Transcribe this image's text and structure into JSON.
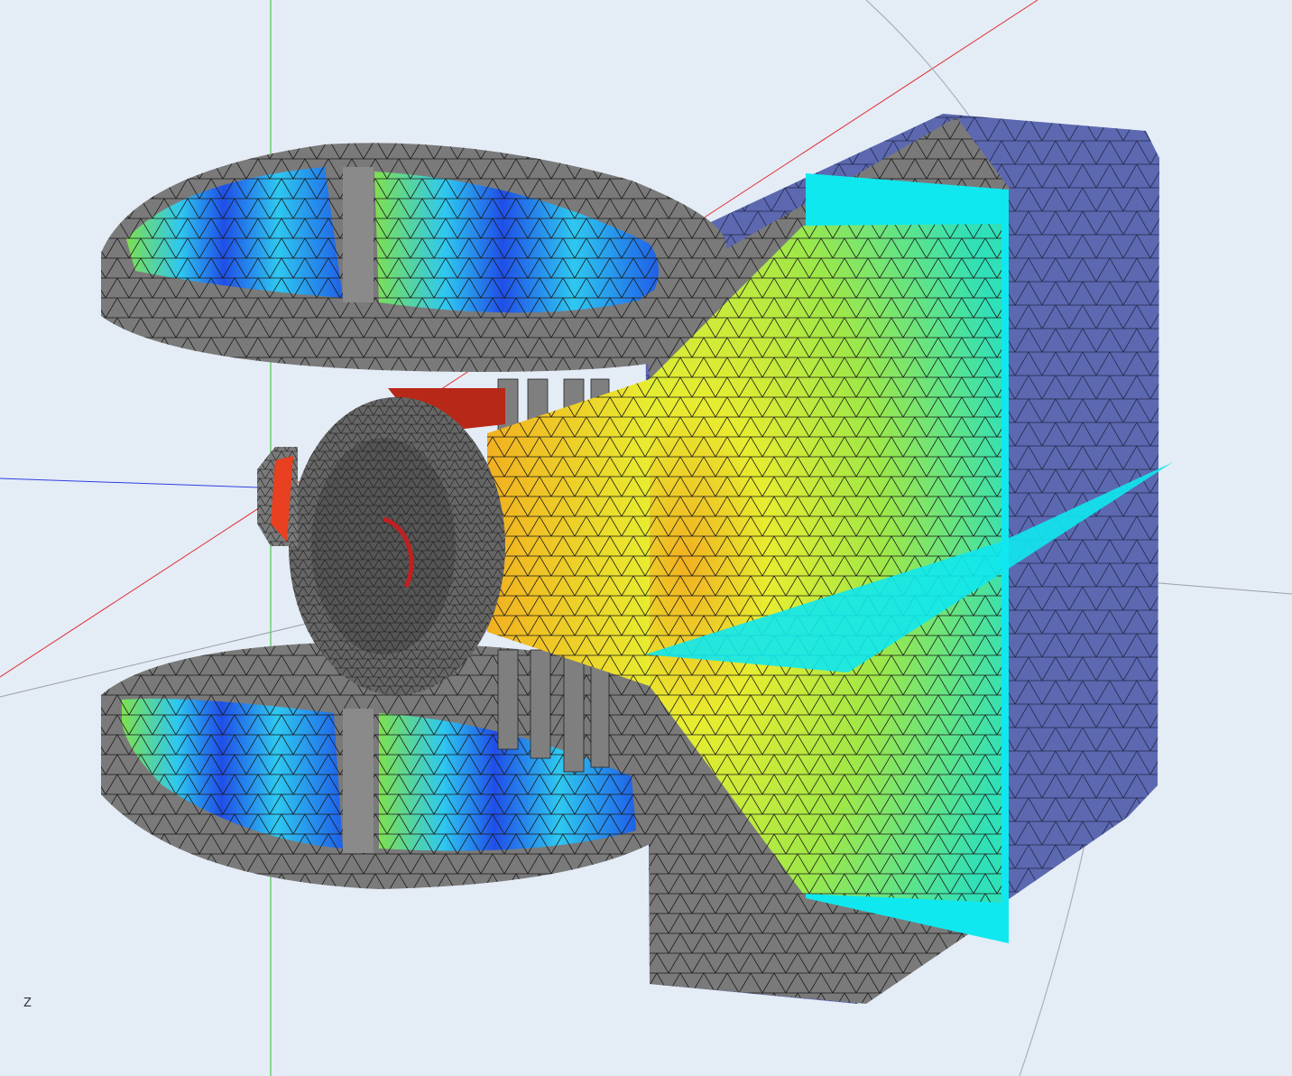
{
  "viewport": {
    "axis_labels": {
      "z": "Z"
    },
    "colors": {
      "background": "#e4ecf6",
      "mesh_gray": "#7a7a7a",
      "mesh_dark": "#555555",
      "mesh_line": "#1a1a1a",
      "navy_box": "#5c68b0",
      "cyan_plane": "#10e8f0",
      "field_blue": "#1f4ee8",
      "field_cyan": "#2ec8f0",
      "field_green": "#7ee050",
      "field_yellow": "#e8ec30",
      "field_orange": "#f2b020",
      "field_red": "#d83010",
      "axis_x": "#e03030",
      "axis_y": "#30c030",
      "axis_z": "#3040e0"
    }
  }
}
